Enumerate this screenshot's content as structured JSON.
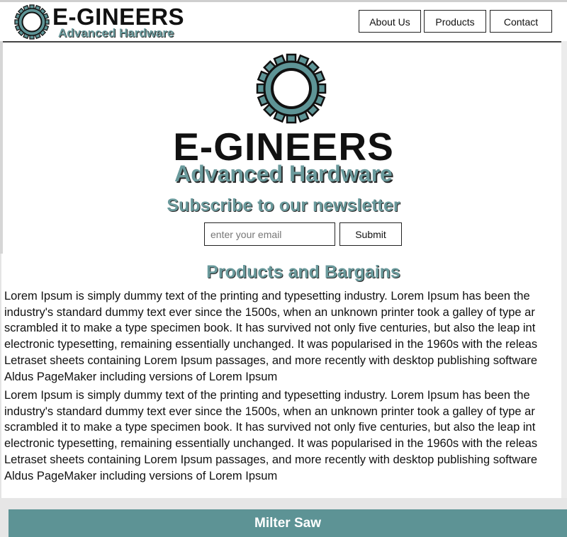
{
  "header": {
    "brand": "E-GINEERS",
    "tagline": "Advanced Hardware",
    "nav": [
      {
        "label": "About Us"
      },
      {
        "label": "Products"
      },
      {
        "label": "Contact"
      }
    ]
  },
  "hero": {
    "brand": "E-GINEERS",
    "tagline": "Advanced Hardware"
  },
  "newsletter": {
    "title": "Subscribe to our newsletter",
    "placeholder": "enter your email",
    "submit_label": "Submit"
  },
  "products": {
    "title": "Products and Bargains",
    "paragraphs": [
      {
        "lines": [
          "Lorem Ipsum is simply dummy text of the printing and typesetting industry. Lorem Ipsum has been the",
          "industry's standard dummy text ever since the 1500s, when an unknown printer took a galley of type ar",
          "scrambled it to make a type specimen book. It has survived not only five centuries, but also the leap int",
          "electronic typesetting, remaining essentially unchanged. It was popularised in the 1960s with the releas",
          "Letraset sheets containing Lorem Ipsum passages, and more recently with desktop publishing software",
          "Aldus PageMaker including versions of Lorem Ipsum"
        ]
      },
      {
        "lines": [
          "Lorem Ipsum is simply dummy text of the printing and typesetting industry. Lorem Ipsum has been the",
          "industry's standard dummy text ever since the 1500s, when an unknown printer took a galley of type ar",
          "scrambled it to make a type specimen book. It has survived not only five centuries, but also the leap int",
          "electronic typesetting, remaining essentially unchanged. It was popularised in the 1960s with the releas",
          "Letraset sheets containing Lorem Ipsum passages, and more recently with desktop publishing software",
          "Aldus PageMaker including versions of Lorem Ipsum"
        ]
      }
    ]
  },
  "product_card": {
    "title": "Milter Saw"
  },
  "colors": {
    "accent": "#6a9a9c",
    "card_header": "#5d9395",
    "gear_fill": "#5e9496",
    "outline": "#111111"
  },
  "icons": {
    "logo": "gear-icon"
  }
}
